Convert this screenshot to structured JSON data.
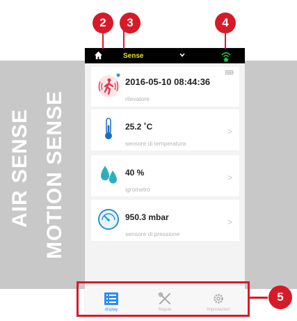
{
  "side_labels": {
    "air": "AIR SENSE",
    "motion": "MOTION SENSE"
  },
  "header": {
    "title": "Sense",
    "home_icon": "home-icon",
    "dropdown_icon": "chevron-down-icon",
    "status_icon": "wifi-signal-icon"
  },
  "cards": [
    {
      "value": "2016-05-10 08:44:36",
      "subtitle": "rilevatore",
      "icon": "motion-person-icon",
      "arrow": ""
    },
    {
      "value": "25.2 ˚C",
      "subtitle": "sensore di temperatura",
      "icon": "thermometer-icon",
      "arrow": ">"
    },
    {
      "value": "40 %",
      "subtitle": "igrometro",
      "icon": "water-drop-icon",
      "arrow": ">"
    },
    {
      "value": "950.3 mbar",
      "subtitle": "sensore di pressione",
      "icon": "gauge-icon",
      "arrow": ">"
    }
  ],
  "tabs": [
    {
      "label": "display",
      "icon": "list-icon",
      "active": true
    },
    {
      "label": "Regole",
      "icon": "tools-icon",
      "active": false
    },
    {
      "label": "Impostazioni",
      "icon": "gear-icon",
      "active": false
    }
  ],
  "annotations": [
    "2",
    "3",
    "4",
    "5"
  ],
  "colors": {
    "accent_red": "#d71a28",
    "header_bg": "#000000",
    "title_yellow": "#e7e51f",
    "active_tab": "#2d8df0",
    "band_grey": "#c8c8c8"
  }
}
